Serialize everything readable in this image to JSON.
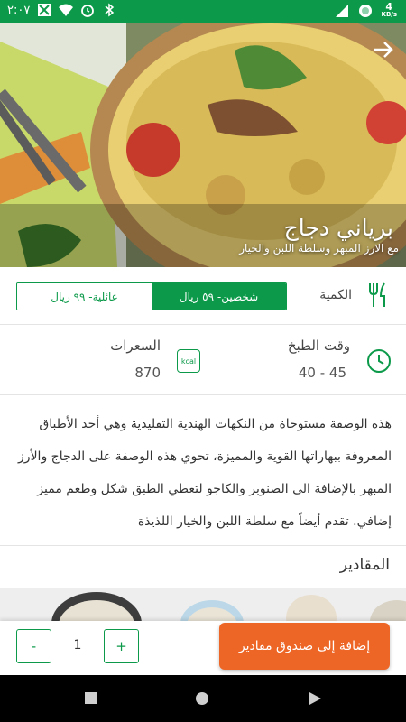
{
  "status_bar": {
    "time": "٢:٠٧",
    "network_speed": "4",
    "network_unit": "KB/s"
  },
  "recipe": {
    "title": "برياني دجاج",
    "subtitle": "مع الارز المبهر وسلطة اللبن والخيار"
  },
  "quantity": {
    "label": "الكمية",
    "options": [
      {
        "label": "شخصين- ٥٩ ريال",
        "selected": true
      },
      {
        "label": "عائلية- ٩٩ ريال",
        "selected": false
      }
    ]
  },
  "info": {
    "cook_time_label": "وقت الطبخ",
    "cook_time_value": "40 - 45",
    "calories_label": "السعرات",
    "calories_value": "870",
    "kcal_badge": "kcal"
  },
  "description": "هذه الوصفة مستوحاة من النكهات الهندية التقليدية وهي أحد الأطباق المعروفة ببهاراتها القوية والمميزة، تحوي هذه الوصفة على الدجاج والأرز المبهر بالإضافة الى الصنوبر والكاجو لتعطي الطبق شكل وطعم مميز إضافي. تقدم أيضاً مع سلطة اللبن والخيار اللذيذة",
  "ingredients": {
    "title": "المقادير"
  },
  "cart": {
    "minus_label": "-",
    "plus_label": "+",
    "quantity": "1",
    "add_button_label": "إضافة إلى صندوق مقادير"
  },
  "colors": {
    "brand_green": "#0c9a4a",
    "accent_orange": "#ee6626"
  },
  "icons": [
    "wifi-off-icon",
    "wifi-icon",
    "alarm-icon",
    "bluetooth-icon",
    "back-arrow-icon",
    "cutlery-icon",
    "clock-icon",
    "kcal-icon",
    "nav-back-icon",
    "nav-home-icon",
    "nav-recents-icon"
  ]
}
